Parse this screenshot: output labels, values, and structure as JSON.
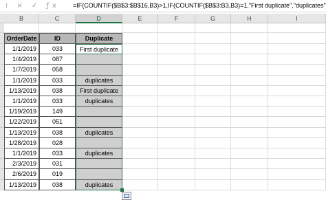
{
  "formula_bar": {
    "formula": "=IF(COUNTIF($B$3:$B$16,B3)>1,IF(COUNTIF($B$3:B3,B3)=1,\"First duplicate\",\"duplicates\"),\"\")"
  },
  "columns": [
    "B",
    "C",
    "D",
    "E",
    "F",
    "G",
    "H",
    "I"
  ],
  "headers": {
    "b": "OrderDate",
    "c": "ID",
    "d": "Duplicate"
  },
  "rows": [
    {
      "date": "1/1/2019",
      "id": "033",
      "dup": "First duplicate"
    },
    {
      "date": "1/4/2019",
      "id": "087",
      "dup": ""
    },
    {
      "date": "1/7/2019",
      "id": "058",
      "dup": ""
    },
    {
      "date": "1/1/2019",
      "id": "033",
      "dup": "duplicates"
    },
    {
      "date": "1/13/2019",
      "id": "038",
      "dup": "First duplicate"
    },
    {
      "date": "1/1/2019",
      "id": "033",
      "dup": "duplicates"
    },
    {
      "date": "1/19/2019",
      "id": "149",
      "dup": ""
    },
    {
      "date": "1/22/2019",
      "id": "051",
      "dup": ""
    },
    {
      "date": "1/13/2019",
      "id": "038",
      "dup": "duplicates"
    },
    {
      "date": "1/28/2019",
      "id": "028",
      "dup": ""
    },
    {
      "date": "1/1/2019",
      "id": "033",
      "dup": "duplicates"
    },
    {
      "date": "2/3/2019",
      "id": "031",
      "dup": ""
    },
    {
      "date": "2/6/2019",
      "id": "019",
      "dup": ""
    },
    {
      "date": "1/13/2019",
      "id": "038",
      "dup": "duplicates"
    }
  ],
  "colors": {
    "selection": "#217346",
    "header_fill": "#b8b8b8",
    "dup_fill": "#cfcfcf"
  }
}
